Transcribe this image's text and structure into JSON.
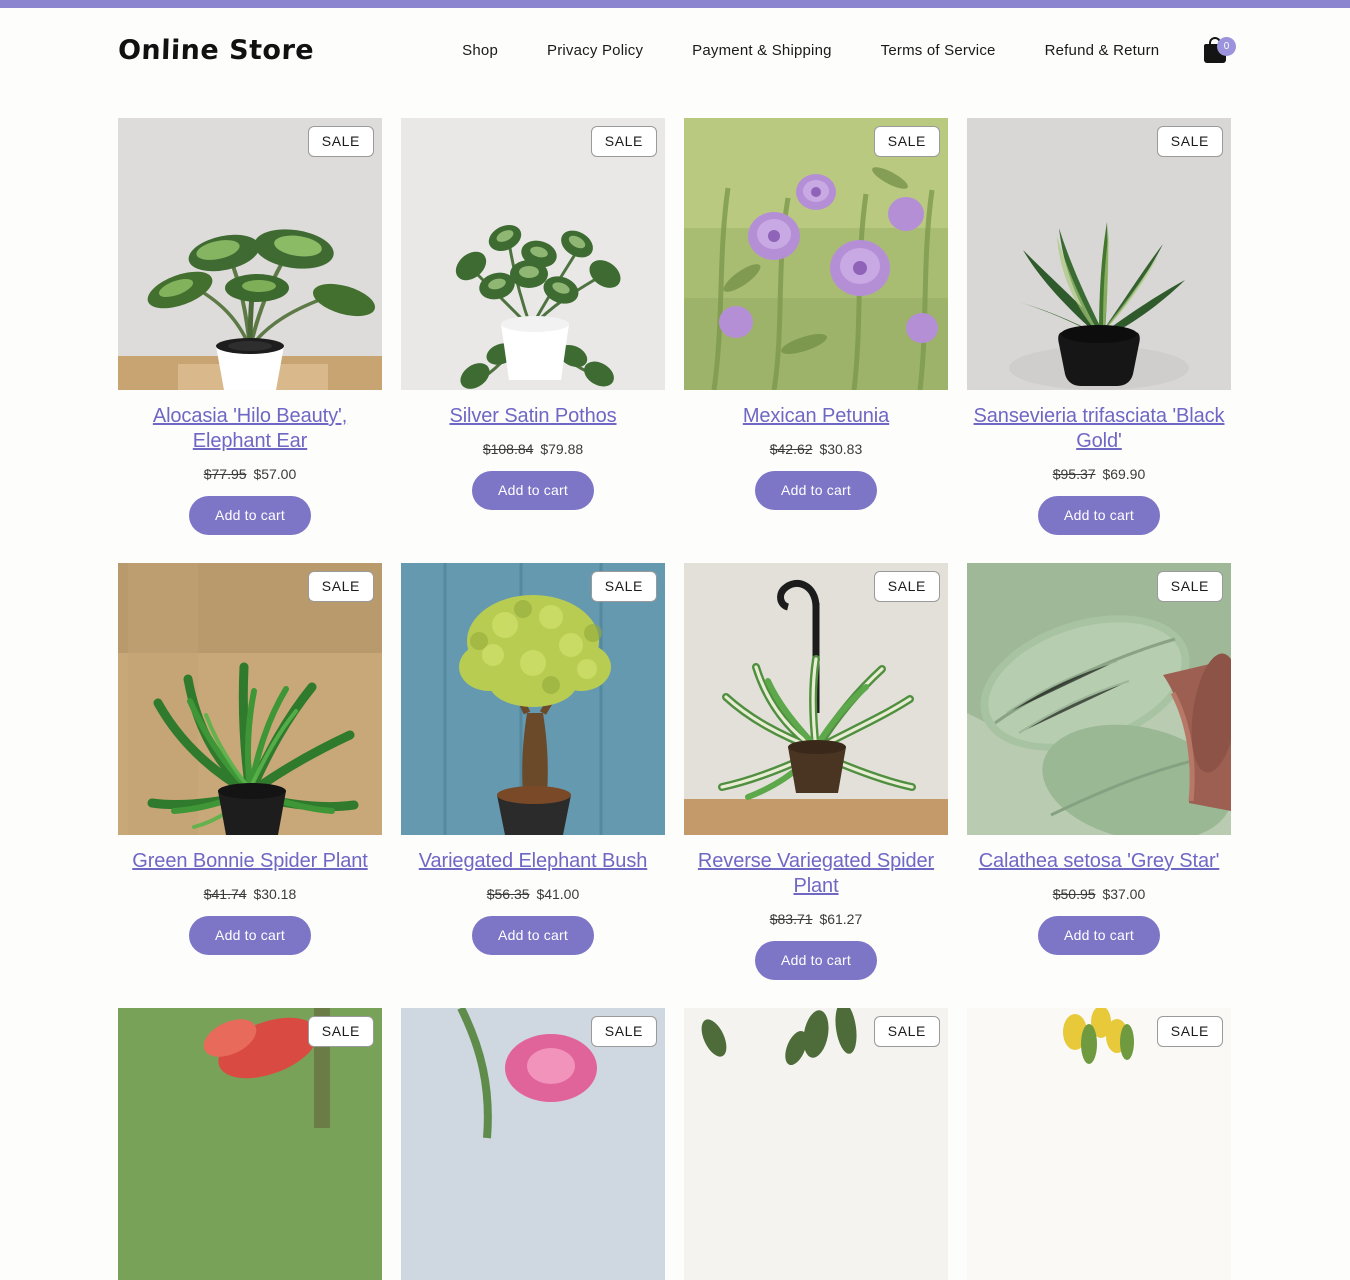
{
  "theme": {
    "accent": "#8b85d0",
    "button": "#7d75c6",
    "link": "#6f67c4",
    "page_bg": "#fdfdfc",
    "badge_bg": "#9b93db"
  },
  "header": {
    "logo": "Online Store",
    "nav": [
      {
        "label": "Shop"
      },
      {
        "label": "Privacy Policy"
      },
      {
        "label": "Payment & Shipping"
      },
      {
        "label": "Terms of Service"
      },
      {
        "label": "Refund & Return"
      }
    ],
    "cart": {
      "icon": "shopping-bag-icon",
      "count": "0"
    }
  },
  "labels": {
    "sale": "SALE",
    "add_to_cart": "Add to cart"
  },
  "products": [
    {
      "title": "Alocasia 'Hilo Beauty', Elephant Ear",
      "old_price": "$77.95",
      "new_price": "$57.00",
      "sale": "SALE",
      "add_to_cart": "Add to cart"
    },
    {
      "title": "Silver Satin Pothos",
      "old_price": "$108.84",
      "new_price": "$79.88",
      "sale": "SALE",
      "add_to_cart": "Add to cart"
    },
    {
      "title": "Mexican Petunia",
      "old_price": "$42.62",
      "new_price": "$30.83",
      "sale": "SALE",
      "add_to_cart": "Add to cart"
    },
    {
      "title": "Sansevieria trifasciata 'Black Gold'",
      "old_price": "$95.37",
      "new_price": "$69.90",
      "sale": "SALE",
      "add_to_cart": "Add to cart"
    },
    {
      "title": "Green Bonnie Spider Plant",
      "old_price": "$41.74",
      "new_price": "$30.18",
      "sale": "SALE",
      "add_to_cart": "Add to cart"
    },
    {
      "title": "Variegated Elephant Bush",
      "old_price": "$56.35",
      "new_price": "$41.00",
      "sale": "SALE",
      "add_to_cart": "Add to cart"
    },
    {
      "title": "Reverse Variegated Spider Plant",
      "old_price": "$83.71",
      "new_price": "$61.27",
      "sale": "SALE",
      "add_to_cart": "Add to cart"
    },
    {
      "title": "Calathea setosa 'Grey Star'",
      "old_price": "$50.95",
      "new_price": "$37.00",
      "sale": "SALE",
      "add_to_cart": "Add to cart"
    }
  ],
  "partial_row": [
    {
      "sale": "SALE"
    },
    {
      "sale": "SALE"
    },
    {
      "sale": "SALE"
    },
    {
      "sale": "SALE"
    }
  ]
}
